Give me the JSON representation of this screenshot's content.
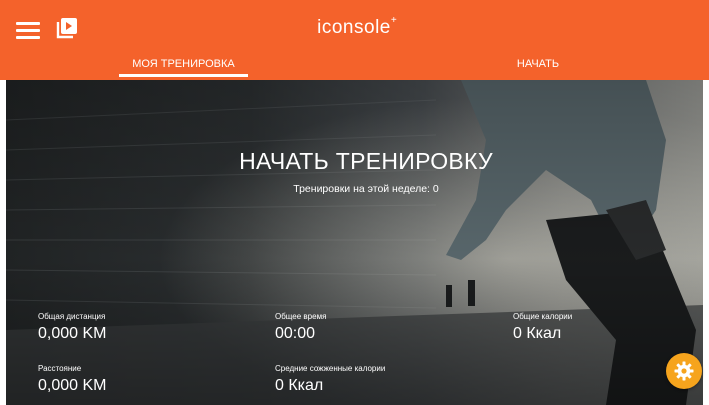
{
  "header": {
    "logo_text": "iconsole",
    "logo_plus": "+",
    "menu_icon": "hamburger-menu-icon",
    "video_icon": "video-play-icon",
    "bg_color": "#f4622b"
  },
  "tabs": [
    {
      "label": "МОЯ ТРЕНИРОВКА",
      "active": true
    },
    {
      "label": "НАЧАТЬ",
      "active": false
    }
  ],
  "hero": {
    "title": "НАЧАТЬ ТРЕНИРОВКУ",
    "subtitle": "Тренировки на этой неделе: 0"
  },
  "stats": {
    "total_distance": {
      "label": "Общая дистанция",
      "value": "0,000 KM"
    },
    "total_time": {
      "label": "Общее время",
      "value": "00:00"
    },
    "total_calories": {
      "label": "Общие калории",
      "value": "0 Ккал"
    },
    "distance": {
      "label": "Расстояние",
      "value": "0,000 KM"
    },
    "avg_calories": {
      "label": "Средние сожженные калории",
      "value": "0 Ккал"
    }
  },
  "fab": {
    "icon": "gear-icon",
    "color": "#f6a41d"
  }
}
